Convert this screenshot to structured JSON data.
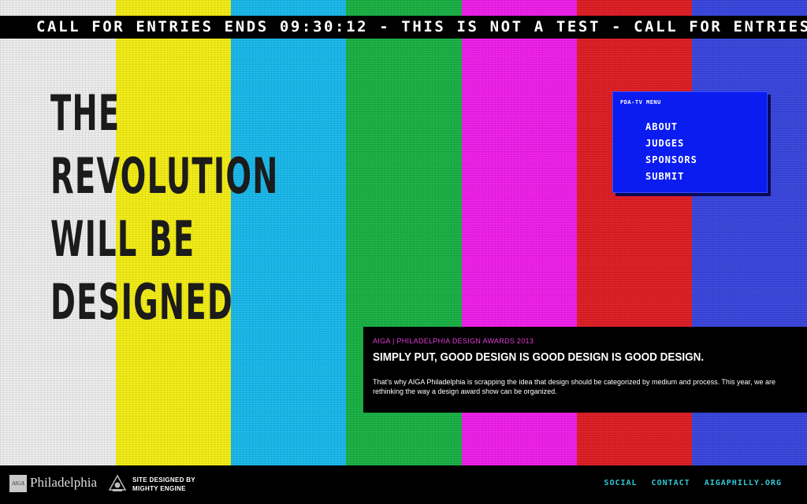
{
  "ticker": {
    "text": "CALL FOR ENTRIES ENDS 09:30:12 - THIS IS NOT A TEST - CALL FOR ENTRIES"
  },
  "headline": {
    "lines": [
      "THE",
      "REVOLUTION",
      "WILL BE",
      "DESIGNED"
    ]
  },
  "menu": {
    "title": "PDA-TV MENU",
    "items": [
      {
        "label": "ABOUT"
      },
      {
        "label": "JUDGES"
      },
      {
        "label": "SPONSORS"
      },
      {
        "label": "SUBMIT"
      }
    ]
  },
  "info": {
    "kicker": "AIGA | PHILADELPHIA DESIGN AWARDS 2013",
    "title": "SIMPLY PUT, GOOD DESIGN IS GOOD DESIGN IS GOOD DESIGN.",
    "body": "That’s why AIGA Philadelphia is scrapping the idea that design should be categorized by medium and process. This year, we are rethinking the way a design award show can be organized."
  },
  "footer": {
    "logo_mark": "AIGA",
    "logo_text": "Philadelphia",
    "credit_line1": "SITE DESIGNED BY",
    "credit_line2": "MIGHTY ENGINE",
    "links": [
      {
        "label": "SOCIAL"
      },
      {
        "label": "CONTACT"
      },
      {
        "label": "AIGAPHILLY.ORG"
      }
    ]
  },
  "colors": {
    "bars": [
      "#ececec",
      "#f2ec14",
      "#18b7ea",
      "#18b043",
      "#ee1ee8",
      "#dd1c24",
      "#3845dc"
    ],
    "menu_bg": "#0a1cf0",
    "accent_pink": "#e23bd6",
    "link_cyan": "#33c8d6"
  }
}
